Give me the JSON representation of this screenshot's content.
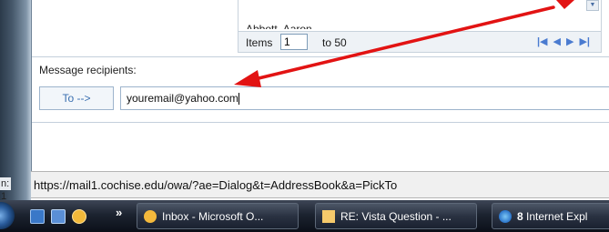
{
  "clipped_left_label": "n: 1",
  "address_book": {
    "partial_contact": "Abbott, Aaron",
    "pager": {
      "items_label": "Items",
      "start_value": "1",
      "to_label": "to 50",
      "nav": {
        "first": "⏮",
        "prev": "◀",
        "next": "▶",
        "last": "⏭"
      }
    }
  },
  "recipients": {
    "section_label": "Message recipients:",
    "to_button_label": "To -->",
    "to_field_value": "youremail@yahoo.com"
  },
  "status_bar": {
    "url": "https://mail1.cochise.edu/owa/?ae=Dialog&t=AddressBook&a=PickTo"
  },
  "taskbar": {
    "quicklaunch_chevron": "»",
    "buttons": [
      {
        "label": "Inbox - Microsoft O...",
        "icon": "outlook-icon"
      },
      {
        "label": "RE: Vista Question - ...",
        "icon": "mail-icon"
      },
      {
        "count": "8",
        "label": "Internet Expl",
        "icon": "ie-icon"
      }
    ]
  },
  "colors": {
    "annotation_arrow": "#e21313",
    "accent_blue": "#3a6fb0",
    "taskbar_dark": "#1c2330"
  }
}
